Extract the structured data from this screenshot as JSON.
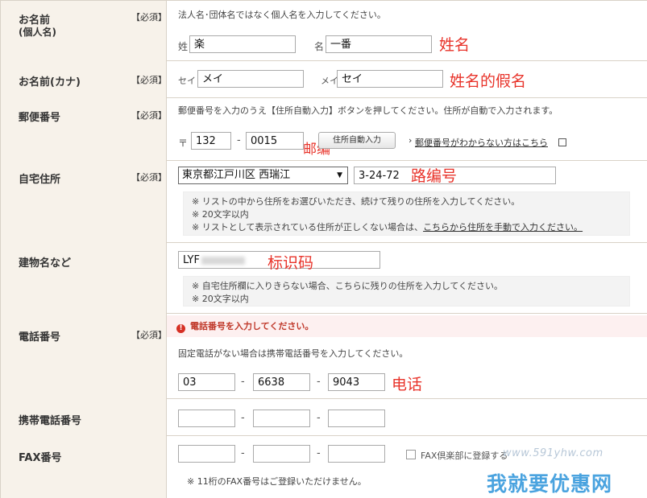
{
  "required_label": "【必須】",
  "name": {
    "label": "お名前",
    "sub_label": "(個人名)",
    "note": "法人名･団体名ではなく個人名を入力してください。",
    "sei_label": "姓",
    "sei_value": "楽",
    "mei_label": "名",
    "mei_value": "一番",
    "annotation": "姓名"
  },
  "kana": {
    "label": "お名前(カナ)",
    "sei_label": "セイ",
    "sei_value": "メイ",
    "mei_label": "メイ",
    "mei_value": "セイ",
    "annotation": "姓名的假名"
  },
  "postal": {
    "label": "郵便番号",
    "note": "郵便番号を入力のうえ【住所自動入力】ボタンを押してください。住所が自動で入力されます。",
    "mark": "〒",
    "part1": "132",
    "part2": "0015",
    "annotation": "邮编",
    "button": "住所自動入力",
    "link_arrow": "›",
    "link": "郵便番号がわからない方はこちら"
  },
  "address": {
    "label": "自宅住所",
    "select_value": "東京都江戸川区 西瑞江",
    "select_arrow": "▼",
    "street_value": "3-24-72",
    "annotation": "路编号",
    "hint1": "※ リストの中から住所をお選びいただき、続けて残りの住所を入力してください。",
    "hint2": "※ 20文字以内",
    "hint3_pre": "※ リストとして表示されている住所が正しくない場合は、",
    "hint3_link": "こちらから住所を手動で入力ください。"
  },
  "building": {
    "label": "建物名など",
    "value": "LYF",
    "annotation": "标识码",
    "hint1": "※ 自宅住所欄に入りきらない場合、こちらに残りの住所を入力してください。",
    "hint2": "※ 20文字以内"
  },
  "phone": {
    "label": "電話番号",
    "error_icon": "!",
    "error": "電話番号を入力してください。",
    "note": "固定電話がない場合は携帯電話番号を入力してください。",
    "part1": "03",
    "part2": "6638",
    "part3": "9043",
    "annotation": "电话"
  },
  "mobile": {
    "label": "携帯電話番号"
  },
  "fax": {
    "label": "FAX番号",
    "checkbox_label": "FAX倶楽部に登録する",
    "note": "※ 11桁のFAX番号はご登録いただけません。"
  },
  "dash": "-",
  "watermark": {
    "url": "www.591yhw.com",
    "name": "我就要优惠网"
  }
}
